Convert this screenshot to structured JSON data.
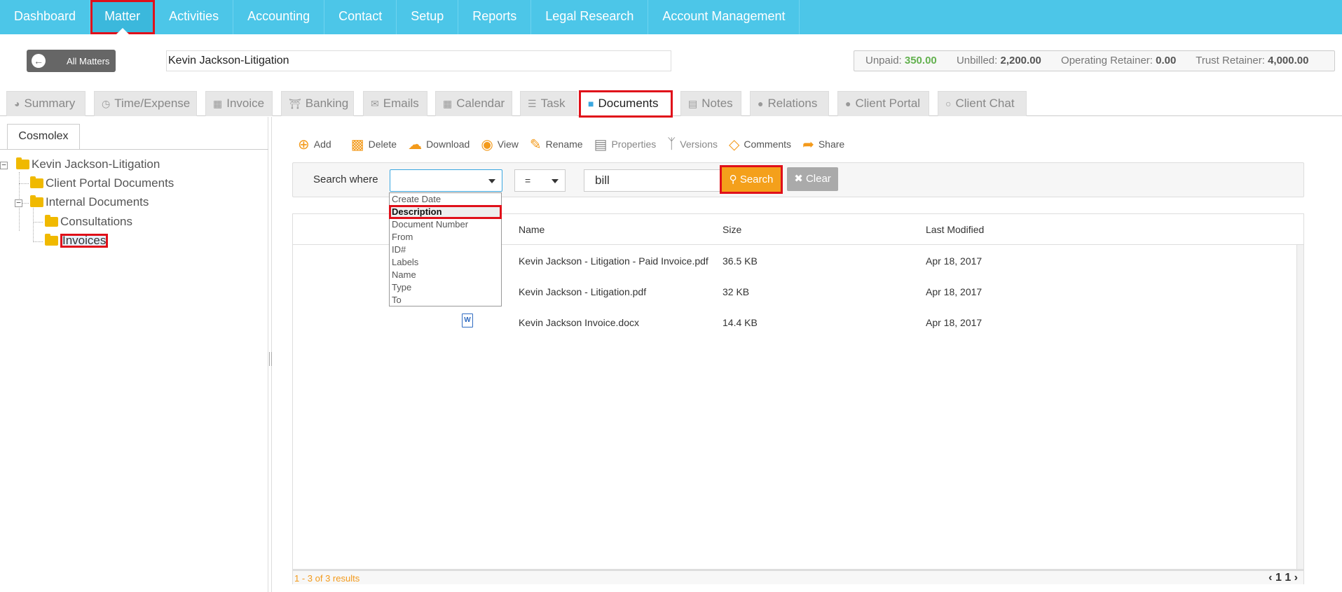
{
  "topnav": {
    "items": [
      {
        "label": "Dashboard"
      },
      {
        "label": "Matter"
      },
      {
        "label": "Activities"
      },
      {
        "label": "Accounting"
      },
      {
        "label": "Contact"
      },
      {
        "label": "Setup"
      },
      {
        "label": "Reports"
      },
      {
        "label": "Legal Research"
      },
      {
        "label": "Account Management"
      }
    ],
    "active": "Matter"
  },
  "matter_bar": {
    "back_label": "All Matters",
    "matter_name": "Kevin Jackson-Litigation",
    "unpaid_label": "Unpaid:",
    "unpaid_value": "350.00",
    "unbilled_label": "Unbilled:",
    "unbilled_value": "2,200.00",
    "operating_label": "Operating Retainer:",
    "operating_value": "0.00",
    "trust_label": "Trust Retainer:",
    "trust_value": "4,000.00"
  },
  "tabs": [
    {
      "label": "Summary",
      "icon": "dashboard-icon"
    },
    {
      "label": "Time/Expense",
      "icon": "clock-icon"
    },
    {
      "label": "Invoice",
      "icon": "table-icon"
    },
    {
      "label": "Banking",
      "icon": "bank-icon"
    },
    {
      "label": "Emails",
      "icon": "envelope-icon"
    },
    {
      "label": "Calendar",
      "icon": "calendar-icon"
    },
    {
      "label": "Task",
      "icon": "tasks-icon"
    },
    {
      "label": "Documents",
      "icon": "folder-icon"
    },
    {
      "label": "Notes",
      "icon": "file-icon"
    },
    {
      "label": "Relations",
      "icon": "users-icon"
    },
    {
      "label": "Client Portal",
      "icon": "users-icon"
    },
    {
      "label": "Client Chat",
      "icon": "chat-icon"
    }
  ],
  "active_tab": "Documents",
  "left_panel": {
    "tab_label": "Cosmolex",
    "tree": {
      "root": "Kevin Jackson-Litigation",
      "client_portal": "Client Portal Documents",
      "internal": "Internal Documents",
      "consultations": "Consultations",
      "invoices": "Invoices"
    },
    "selected_folder": "Invoices"
  },
  "toolbar": {
    "add": "Add",
    "delete": "Delete",
    "download": "Download",
    "view": "View",
    "rename": "Rename",
    "properties": "Properties",
    "versions": "Versions",
    "comments": "Comments",
    "share": "Share"
  },
  "search": {
    "label": "Search where",
    "field_value": "",
    "operator": "=",
    "query": "bill",
    "search_button": "Search",
    "clear_button": "Clear",
    "field_options": [
      "Create Date",
      "Description",
      "Document Number",
      "From",
      "ID#",
      "Labels",
      "Name",
      "Type",
      "To"
    ],
    "highlighted_option": "Description"
  },
  "grid": {
    "columns": {
      "name": "Name",
      "size": "Size",
      "modified": "Last Modified"
    },
    "rows": [
      {
        "name": "Kevin Jackson - Litigation - Paid Invoice.pdf",
        "size": "36.5 KB",
        "modified": "Apr 18, 2017",
        "icon": "pdf-icon"
      },
      {
        "name": "Kevin Jackson - Litigation.pdf",
        "size": "32 KB",
        "modified": "Apr 18, 2017",
        "icon": "pdf-icon"
      },
      {
        "name": "Kevin Jackson Invoice.docx",
        "size": "14.4 KB",
        "modified": "Apr 18, 2017",
        "icon": "word-doc-icon"
      }
    ],
    "results_text": "1 - 3 of 3 results",
    "pager_prev": "‹",
    "pager_page": "1",
    "pager_total": "1",
    "pager_next": "›"
  },
  "colors": {
    "nav_bg": "#4cc6e8",
    "accent_orange": "#f4a01b",
    "highlight_red": "#e0101a",
    "unpaid_green": "#63b14f"
  }
}
